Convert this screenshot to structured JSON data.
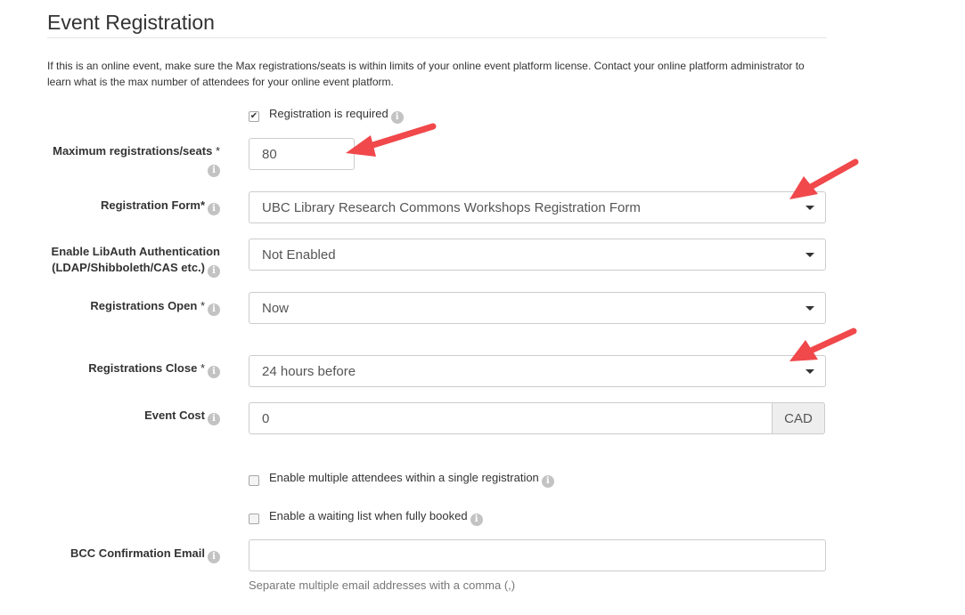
{
  "page": {
    "title": "Event Registration",
    "info_text": "If this is an online event, make sure the Max registrations/seats is within limits of your online event platform license. Contact your online platform administrator to learn what is the max number of attendees for your online event platform."
  },
  "form": {
    "registration_required": {
      "label": "Registration is required",
      "checked": true
    },
    "max_seats": {
      "label": "Maximum registrations/seats",
      "required_mark": "*",
      "value": "80"
    },
    "registration_form": {
      "label": "Registration Form*",
      "value": "UBC Library Research Commons Workshops Registration Form"
    },
    "libauth": {
      "label_line1": "Enable LibAuth Authentication",
      "label_line2": "(LDAP/Shibboleth/CAS etc.)",
      "value": "Not Enabled"
    },
    "registrations_open": {
      "label": "Registrations Open",
      "required_mark": "*",
      "value": "Now"
    },
    "registrations_close": {
      "label": "Registrations Close",
      "required_mark": "*",
      "value": "24 hours before"
    },
    "event_cost": {
      "label": "Event Cost",
      "value": "0",
      "currency": "CAD"
    },
    "multiple_attendees": {
      "label": "Enable multiple attendees within a single registration",
      "checked": false
    },
    "waiting_list": {
      "label": "Enable a waiting list when fully booked",
      "checked": false
    },
    "bcc_email": {
      "label": "BCC Confirmation Email",
      "value": "",
      "help": "Separate multiple email addresses with a comma (,)"
    }
  },
  "icons": {
    "info": "info-icon",
    "annotation": "red-arrow-annotation"
  },
  "colors": {
    "annotation_arrow": "#f0484b",
    "info_icon": "#c3c3c3",
    "addon_bg": "#eeeeee"
  }
}
